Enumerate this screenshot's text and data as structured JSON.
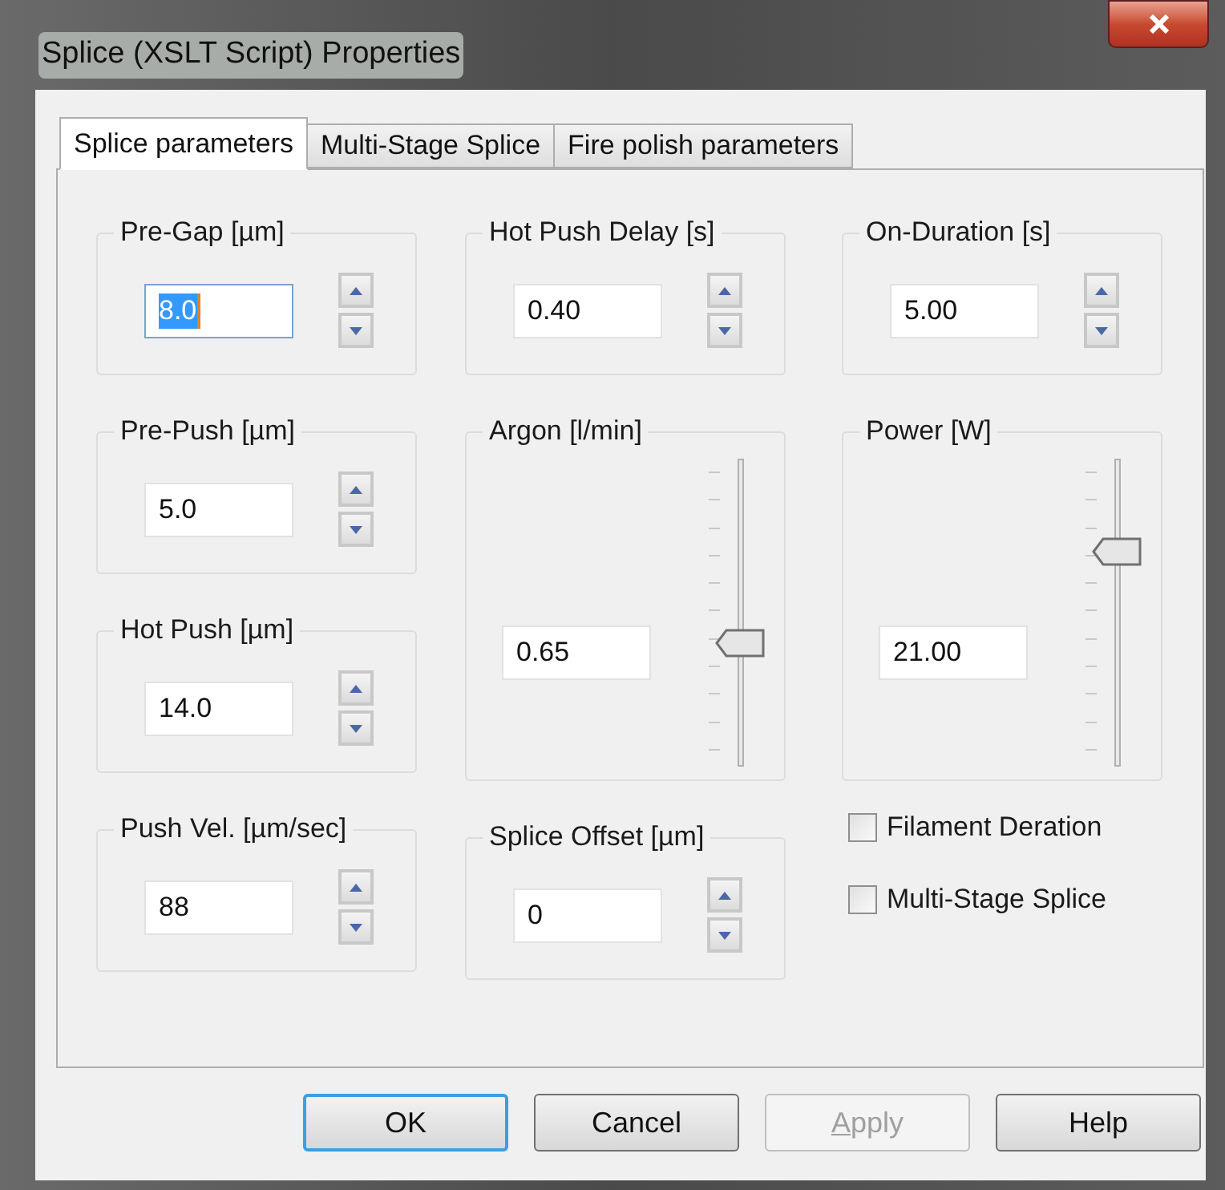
{
  "window": {
    "title": "Splice (XSLT Script) Properties"
  },
  "tabs": [
    {
      "label": "Splice parameters",
      "selected": true
    },
    {
      "label": "Multi-Stage Splice",
      "selected": false
    },
    {
      "label": "Fire polish parameters",
      "selected": false
    }
  ],
  "columns": [
    [
      {
        "kind": "spin",
        "label": "Pre-Gap [µm]",
        "value": "8.0",
        "text_selected": true
      },
      {
        "kind": "spin",
        "label": "Pre-Push [µm]",
        "value": "5.0",
        "text_selected": false
      },
      {
        "kind": "spin",
        "label": "Hot Push [µm]",
        "value": "14.0",
        "text_selected": false
      },
      {
        "kind": "spin",
        "label": "Push Vel.  [µm/sec]",
        "value": "88",
        "text_selected": false
      }
    ],
    [
      {
        "kind": "spin",
        "label": "Hot Push Delay [s]",
        "value": "0.40",
        "text_selected": false
      },
      {
        "kind": "slider",
        "label": "Argon [l/min]",
        "value": "0.65",
        "level": 0.35
      },
      {
        "kind": "spin",
        "label": "Splice Offset [µm]",
        "value": "0",
        "text_selected": false
      }
    ],
    [
      {
        "kind": "spin",
        "label": "On-Duration [s]",
        "value": "5.00",
        "text_selected": false
      },
      {
        "kind": "slider",
        "label": "Power [W]",
        "value": "21.00",
        "level": 0.68
      },
      {
        "kind": "check",
        "label": "Filament Deration",
        "checked": false
      },
      {
        "kind": "check",
        "label": "Multi-Stage Splice",
        "checked": false
      }
    ]
  ],
  "buttons": [
    {
      "label": "OK",
      "default": true,
      "disabled": false,
      "mnemonic": false
    },
    {
      "label": "Cancel",
      "default": false,
      "disabled": false,
      "mnemonic": false
    },
    {
      "label": "Apply",
      "default": false,
      "disabled": true,
      "mnemonic": true
    },
    {
      "label": "Help",
      "default": false,
      "disabled": false,
      "mnemonic": false
    }
  ]
}
